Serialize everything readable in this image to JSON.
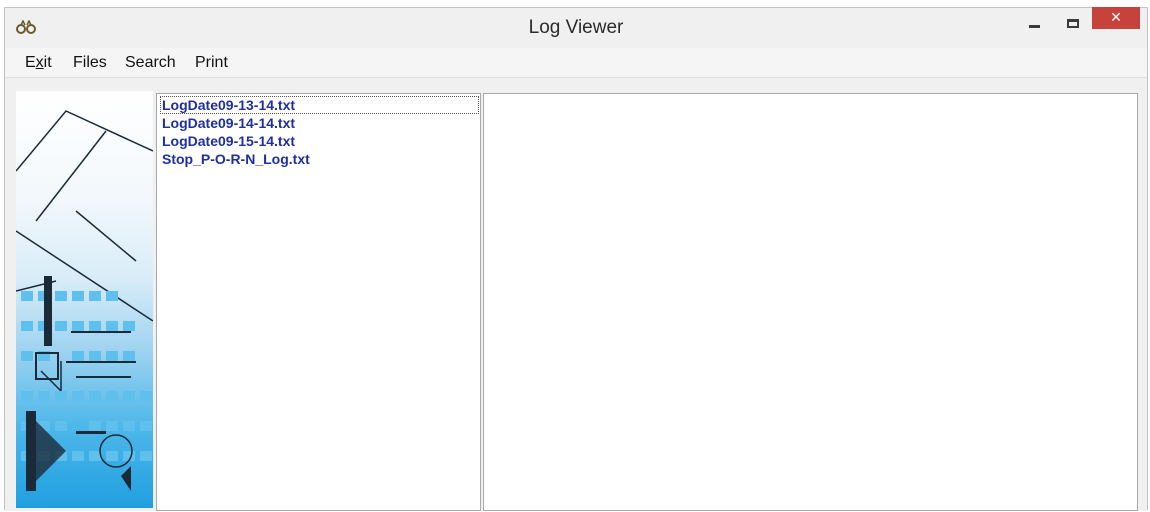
{
  "window": {
    "title": "Log Viewer",
    "icon": "binoculars-icon",
    "controls": {
      "minimize": "minimize-icon",
      "maximize": "maximize-icon",
      "close_label": "✕"
    }
  },
  "menu": {
    "exit": {
      "access_key": "x",
      "before": "E",
      "after": "it"
    },
    "files": "Files",
    "search": "Search",
    "print": "Print"
  },
  "file_list": {
    "items": [
      "LogDate09-13-14.txt",
      "LogDate09-14-14.txt",
      "LogDate09-15-14.txt",
      "Stop_P-O-R-N_Log.txt"
    ],
    "selected_index": 0
  },
  "colors": {
    "file_text": "#1e2fa0",
    "close_button": "#c7423a",
    "window_bg": "#f0f0f0"
  }
}
